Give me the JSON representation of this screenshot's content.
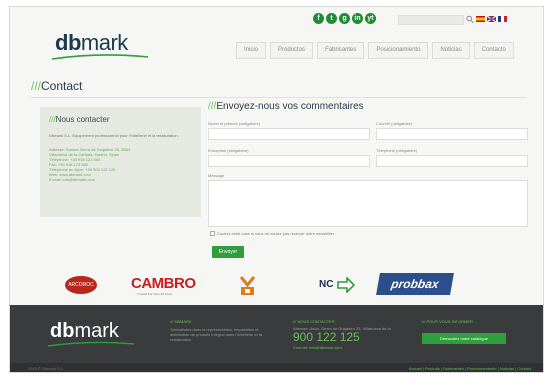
{
  "header": {
    "logo_bold": "db",
    "logo_light": "mark",
    "social_icons": [
      "f",
      "t",
      "g",
      "in",
      "yt"
    ],
    "nav": [
      "Inicio",
      "Productos",
      "Fabricantes",
      "Posicionamiento",
      "Noticias",
      "Contacto"
    ]
  },
  "page": {
    "title_prefix": "///",
    "title": "Contact"
  },
  "sidebar": {
    "title_prefix": "///",
    "title": "Nous contacter",
    "description": "Dbmark S.L. Equipement professionnel pour l'hôtellerie et la restauration.",
    "address_lines": [
      "Adresse: Santos Sierra de Grajalero 25, 2B63",
      "Villanueva de la Cañada, Madrid, Spain",
      "Téléphone: +34 915 123 582",
      "Fax: +34 916 123 582",
      "Téléphone en ligne: +34 900 122 125",
      "Web: www.dbmark.com",
      "E-mail: info@dbmark.com"
    ]
  },
  "form": {
    "title_prefix": "///",
    "title": "Envoyez-nous vos commentaires",
    "name_label": "Nome et prénom (obligatoire)",
    "email_label": "Courriel (obligatoire)",
    "company_label": "Entreprise (obligatoire)",
    "phone_label": "Téléphone (obligatoire)",
    "message_label": "Message",
    "newsletter_label": "Cochez cette case si vous ne voulez pas recevoir notre newsletter",
    "submit_label": "Envoyer"
  },
  "brands": {
    "oval": "ARCOROC",
    "cambro": "CAMBRO",
    "cambro_sub": "Trusted For Over 40 Years",
    "ncc": "NC",
    "probbax": "probbax"
  },
  "footer": {
    "logo_bold": "db",
    "logo_light": "mark",
    "col1_title": "/// DBMARK",
    "col1_text": "Spécialistes dans la représentation, importation et distribution de produits intégral dans l'hôtellerie et la restauration.",
    "col2_title": "/// NOUS CONTACTER",
    "col2_text": "Adresse: Avda. Sierra de Grajalero 25, Villanueva de la Cañada, Madrid - Spain",
    "col2_email": "Courriel: info@dbmark.com",
    "phone": "900 122 125",
    "col3_title": "/// POUR VOUS INFORMER",
    "newsletter_button": "Demandez notre catalogue",
    "copyright": "2013 © Dbmark S.L.",
    "links": "Accueil | Produits | Fabricantes | Posicionamiento | Noticias | Contact"
  },
  "colors": {
    "accent_green": "#2f9e3c",
    "title_green": "#6ac259",
    "footer_bg": "#3a3b3c",
    "logo_navy": "#1c3a4e"
  }
}
